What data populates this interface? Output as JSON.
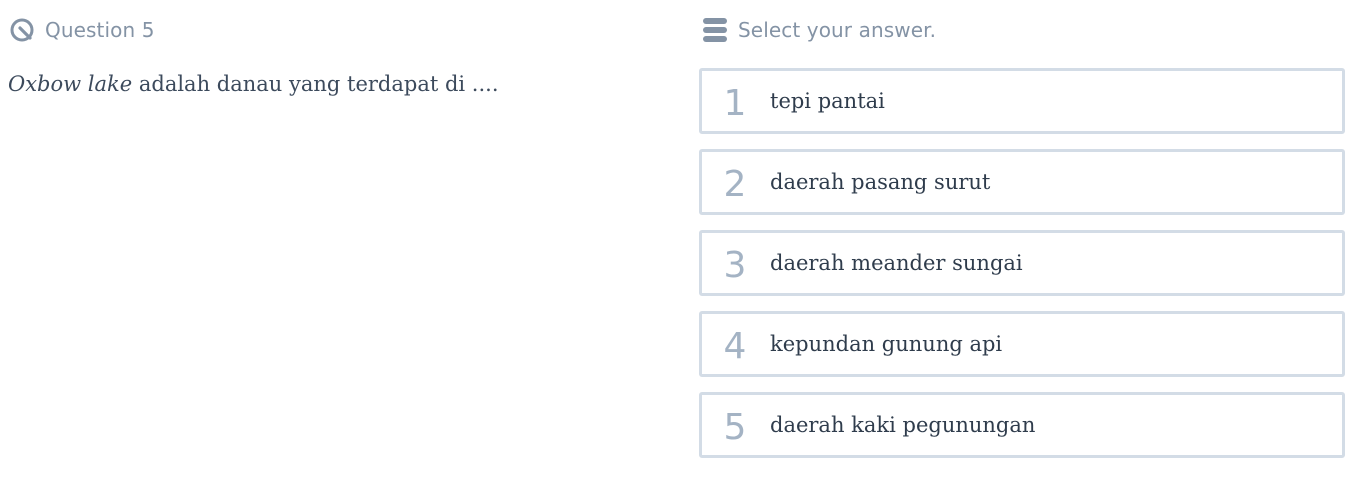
{
  "question": {
    "header_label": "Question 5",
    "header_icon": "question-gauge-icon",
    "text_italic": "Oxbow lake",
    "text_rest": " adalah danau yang terdapat di ...."
  },
  "answer_panel": {
    "header_label": "Select your answer.",
    "header_icon": "list-icon",
    "options": [
      {
        "number": "1",
        "label": "tepi pantai"
      },
      {
        "number": "2",
        "label": "daerah pasang surut"
      },
      {
        "number": "3",
        "label": "daerah meander sungai"
      },
      {
        "number": "4",
        "label": "kepundan gunung api"
      },
      {
        "number": "5",
        "label": "daerah kaki pegunungan"
      }
    ]
  },
  "colors": {
    "muted_text": "#8493a5",
    "option_border": "#d3dce6",
    "option_number": "#a4b3c4",
    "body_text": "#3c4a5c"
  }
}
